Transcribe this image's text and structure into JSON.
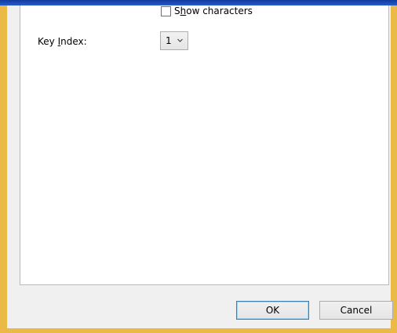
{
  "checkbox": {
    "label_prefix": "S",
    "label_accel": "h",
    "label_rest": "ow characters",
    "checked": false
  },
  "key_index": {
    "label_prefix": "Key ",
    "label_accel": "I",
    "label_rest": "ndex:",
    "selected": "1"
  },
  "buttons": {
    "ok": "OK",
    "cancel": "Cancel"
  },
  "colors": {
    "frame": "#eab946",
    "title_bar": "#1c4bb6",
    "panel": "#ffffff",
    "dialog": "#f0f0f0"
  }
}
